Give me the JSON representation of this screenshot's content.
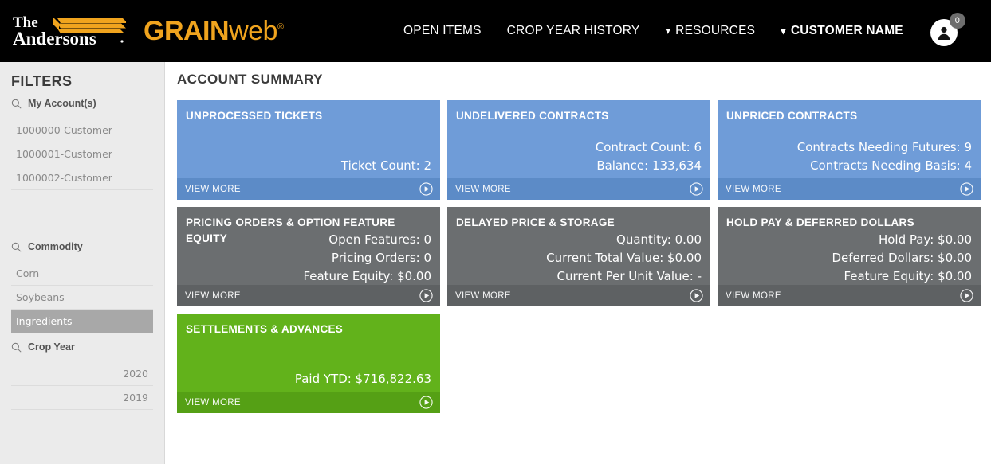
{
  "header": {
    "brand_primary": "The Andersons",
    "brand_product_bold": "GRAIN",
    "brand_product_light": "web",
    "brand_registered": "®",
    "brand_color": "#f0a41e",
    "nav": [
      {
        "label": "OPEN ITEMS",
        "has_caret": false,
        "bold": false
      },
      {
        "label": "CROP YEAR HISTORY",
        "has_caret": false,
        "bold": false
      },
      {
        "label": "RESOURCES",
        "has_caret": true,
        "bold": false
      },
      {
        "label": "CUSTOMER NAME",
        "has_caret": true,
        "bold": true
      }
    ],
    "avatar_badge_count": "0"
  },
  "sidebar": {
    "title": "FILTERS",
    "groups": [
      {
        "label": "My Account(s)",
        "icon": "search-icon",
        "align": "left",
        "items": [
          {
            "label": "1000000-Customer",
            "selected": false
          },
          {
            "label": "1000001-Customer",
            "selected": false
          },
          {
            "label": "1000002-Customer",
            "selected": false
          }
        ]
      },
      {
        "label": "Commodity",
        "icon": "search-icon",
        "align": "left",
        "items": [
          {
            "label": "Corn",
            "selected": false
          },
          {
            "label": "Soybeans",
            "selected": false
          },
          {
            "label": "Ingredients",
            "selected": true
          }
        ]
      },
      {
        "label": "Crop Year",
        "icon": "search-icon",
        "align": "right",
        "items": [
          {
            "label": "2020",
            "selected": false
          },
          {
            "label": "2019",
            "selected": false
          }
        ]
      }
    ]
  },
  "main": {
    "page_title": "ACCOUNT SUMMARY",
    "view_more_label": "VIEW MORE",
    "cards": [
      {
        "title": "UNPROCESSED TICKETS",
        "color": "blue",
        "color_hex": "#6f9cd8",
        "stats_position": "bottom",
        "stats": [
          "Ticket Count: 2"
        ]
      },
      {
        "title": "UNDELIVERED CONTRACTS",
        "color": "blue",
        "color_hex": "#6f9cd8",
        "stats_position": "bottom",
        "stats": [
          "Contract Count: 6",
          "Balance: 133,634"
        ]
      },
      {
        "title": "UNPRICED CONTRACTS",
        "color": "blue",
        "color_hex": "#6f9cd8",
        "stats_position": "bottom",
        "stats": [
          "Contracts Needing Futures: 9",
          "Contracts Needing Basis: 4"
        ]
      },
      {
        "title": "PRICING ORDERS & OPTION FEATURE EQUITY",
        "color": "gray",
        "color_hex": "#6b6e70",
        "stats_position": "top",
        "stats": [
          "Open Features: 0",
          "Pricing Orders: 0",
          "Feature Equity: $0.00"
        ]
      },
      {
        "title": "DELAYED PRICE & STORAGE",
        "color": "gray",
        "color_hex": "#6b6e70",
        "stats_position": "top",
        "stats": [
          "Quantity: 0.00",
          "Current Total Value: $0.00",
          "Current Per Unit Value: -"
        ]
      },
      {
        "title": "HOLD PAY & DEFERRED DOLLARS",
        "color": "gray",
        "color_hex": "#6b6e70",
        "stats_position": "top",
        "stats": [
          "Hold Pay: $0.00",
          "Deferred Dollars: $0.00",
          "Feature Equity: $0.00"
        ]
      },
      {
        "title": "SETTLEMENTS & ADVANCES",
        "color": "green",
        "color_hex": "#62b21b",
        "stats_position": "bottom",
        "stats": [
          "Paid YTD: $716,822.63"
        ]
      }
    ]
  }
}
